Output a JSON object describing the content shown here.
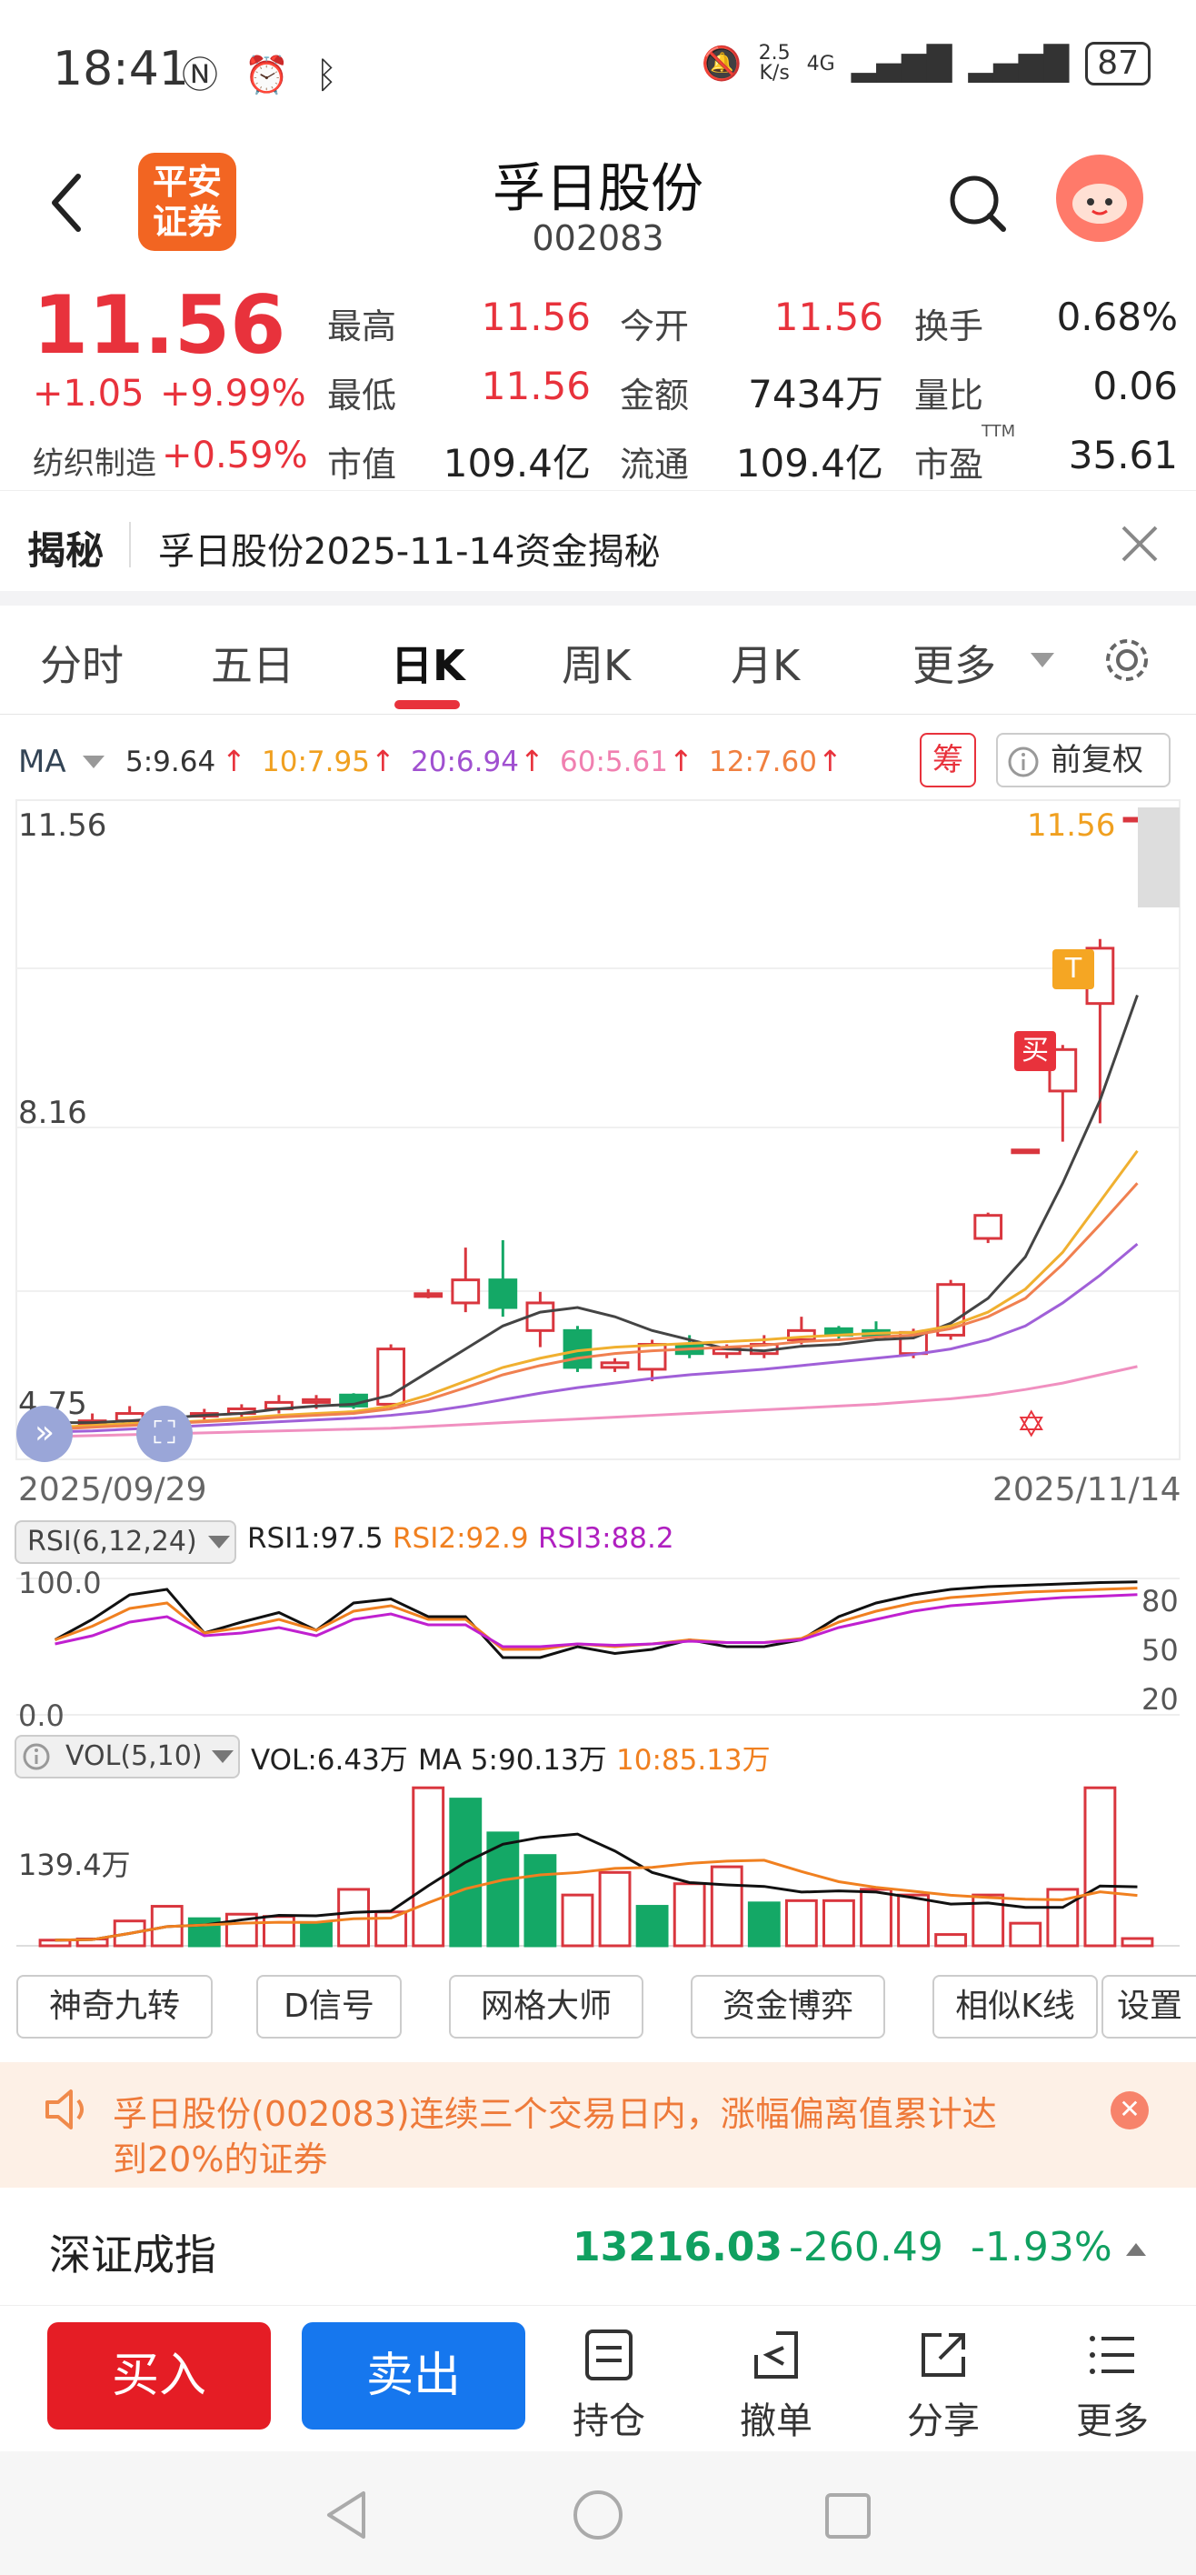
{
  "status_bar": {
    "time": "18:41",
    "network_speed_top": "2.5",
    "network_speed_bottom": "K/s",
    "network_type": "4G",
    "battery": "87"
  },
  "header": {
    "title": "孚日股份",
    "code": "002083",
    "logo_line1": "平安",
    "logo_line2": "证券"
  },
  "quote": {
    "price": "11.56",
    "change": "+1.05",
    "change_pct": "+9.99%",
    "sector_name": "纺织制造",
    "sector_pct": "+0.59%",
    "fields": [
      {
        "label": "最高",
        "value": "11.56"
      },
      {
        "label": "今开",
        "value": "11.56"
      },
      {
        "label": "换手",
        "value": "0.68%"
      },
      {
        "label": "最低",
        "value": "11.56"
      },
      {
        "label": "金额",
        "value": "7434万"
      },
      {
        "label": "量比",
        "value": "0.06"
      },
      {
        "label": "市值",
        "value": "109.4亿"
      },
      {
        "label": "流通",
        "value": "109.4亿"
      },
      {
        "label": "市盈",
        "value": "35.61",
        "sup": "TTM"
      }
    ]
  },
  "reveal": {
    "tag": "揭秘",
    "text": "孚日股份2025-11-14资金揭秘"
  },
  "tabs": [
    "分时",
    "五日",
    "日K",
    "周K",
    "月K",
    "更多"
  ],
  "active_tab": "日K",
  "ma": {
    "label": "MA",
    "items": [
      {
        "text": "5:9.64",
        "color": "#333333"
      },
      {
        "text": "10:7.95",
        "color": "#f0a020"
      },
      {
        "text": "20:6.94",
        "color": "#a050d0"
      },
      {
        "text": "60:5.61",
        "color": "#f080b0"
      },
      {
        "text": "12:7.60",
        "color": "#f08040"
      }
    ],
    "chip_button": "筹",
    "adjust_button": "前复权"
  },
  "kline": {
    "y_high": "11.56",
    "y_mid": "8.16",
    "y_low": "4.75",
    "last_price_label": "11.56",
    "date_start": "2025/09/29",
    "date_end": "2025/11/14",
    "buy_marker": "买",
    "t_marker": "T"
  },
  "rsi": {
    "selector": "RSI(6,12,24)",
    "rsi1": "RSI1:97.5",
    "rsi2": "RSI2:92.9",
    "rsi3": "RSI3:88.2",
    "ticks": [
      "100.0",
      "0.0"
    ],
    "right_ticks": [
      "80",
      "50",
      "20"
    ]
  },
  "vol": {
    "selector": "VOL(5,10)",
    "vol": "VOL:6.43万",
    "ma5": "MA 5:90.13万",
    "ma10": "10:85.13万",
    "y_label": "139.4万"
  },
  "tools": [
    "神奇九转",
    "D信号",
    "网格大师",
    "资金博弈",
    "相似K线",
    "设置"
  ],
  "alert": {
    "text_line1": "孚日股份(002083)连续三个交易日内，涨幅偏离值累计达",
    "text_line2": "到20%的证券"
  },
  "index": {
    "name": "深证成指",
    "value": "13216.03",
    "change": "-260.49",
    "pct": "-1.93%"
  },
  "trade": {
    "buy": "买入",
    "sell": "卖出",
    "actions": [
      {
        "label": "持仓",
        "icon": "document-icon"
      },
      {
        "label": "撤单",
        "icon": "undo-icon"
      },
      {
        "label": "分享",
        "icon": "share-icon"
      },
      {
        "label": "更多",
        "icon": "list-icon"
      }
    ]
  },
  "chart_data": [
    {
      "type": "candlestick",
      "x_range": [
        "2025/09/29",
        "2025/11/14"
      ],
      "ylim": [
        4.75,
        11.56
      ],
      "candles": [
        {
          "o": 4.95,
          "c": 5.0,
          "h": 5.05,
          "l": 4.88
        },
        {
          "o": 5.0,
          "c": 5.02,
          "h": 5.1,
          "l": 4.95
        },
        {
          "o": 5.02,
          "c": 5.1,
          "h": 5.18,
          "l": 4.98
        },
        {
          "o": 5.05,
          "c": 5.08,
          "h": 5.15,
          "l": 5.0
        },
        {
          "o": 5.08,
          "c": 5.1,
          "h": 5.15,
          "l": 5.02
        },
        {
          "o": 5.1,
          "c": 5.15,
          "h": 5.2,
          "l": 5.05
        },
        {
          "o": 5.15,
          "c": 5.22,
          "h": 5.3,
          "l": 5.1
        },
        {
          "o": 5.22,
          "c": 5.25,
          "h": 5.3,
          "l": 5.15
        },
        {
          "o": 5.3,
          "c": 5.18,
          "h": 5.32,
          "l": 5.15
        },
        {
          "o": 5.2,
          "c": 5.8,
          "h": 5.85,
          "l": 5.15
        },
        {
          "o": 6.38,
          "c": 6.4,
          "h": 6.45,
          "l": 6.35
        },
        {
          "o": 6.3,
          "c": 6.55,
          "h": 6.9,
          "l": 6.2
        },
        {
          "o": 6.55,
          "c": 6.25,
          "h": 6.98,
          "l": 6.15
        },
        {
          "o": 6.0,
          "c": 6.3,
          "h": 6.42,
          "l": 5.82
        },
        {
          "o": 6.0,
          "c": 5.6,
          "h": 6.05,
          "l": 5.55
        },
        {
          "o": 5.6,
          "c": 5.65,
          "h": 5.7,
          "l": 5.55
        },
        {
          "o": 5.58,
          "c": 5.85,
          "h": 5.9,
          "l": 5.45
        },
        {
          "o": 5.85,
          "c": 5.75,
          "h": 5.95,
          "l": 5.7
        },
        {
          "o": 5.75,
          "c": 5.8,
          "h": 5.85,
          "l": 5.7
        },
        {
          "o": 5.75,
          "c": 5.85,
          "h": 5.95,
          "l": 5.7
        },
        {
          "o": 5.9,
          "c": 6.0,
          "h": 6.15,
          "l": 5.85
        },
        {
          "o": 6.02,
          "c": 5.95,
          "h": 6.05,
          "l": 5.9
        },
        {
          "o": 6.0,
          "c": 5.95,
          "h": 6.1,
          "l": 5.9
        },
        {
          "o": 5.75,
          "c": 5.98,
          "h": 6.02,
          "l": 5.7
        },
        {
          "o": 5.95,
          "c": 6.5,
          "h": 6.55,
          "l": 5.9
        },
        {
          "o": 7.0,
          "c": 7.25,
          "h": 7.28,
          "l": 6.95
        },
        {
          "o": 7.95,
          "c": 7.96,
          "h": 7.97,
          "l": 7.94
        },
        {
          "o": 8.6,
          "c": 9.05,
          "h": 9.1,
          "l": 8.05
        },
        {
          "o": 9.55,
          "c": 10.15,
          "h": 10.25,
          "l": 8.25
        },
        {
          "o": 11.56,
          "c": 11.56,
          "h": 11.56,
          "l": 11.56
        }
      ],
      "ma_lines": {
        "MA5": [
          5.0,
          5.0,
          5.02,
          5.05,
          5.08,
          5.1,
          5.15,
          5.18,
          5.2,
          5.3,
          5.55,
          5.8,
          6.05,
          6.2,
          6.25,
          6.15,
          6.0,
          5.9,
          5.8,
          5.78,
          5.83,
          5.85,
          5.9,
          5.92,
          6.08,
          6.35,
          6.8,
          7.6,
          8.5,
          9.64
        ],
        "MA10": [
          4.95,
          4.97,
          4.99,
          5.0,
          5.02,
          5.05,
          5.08,
          5.1,
          5.12,
          5.18,
          5.3,
          5.45,
          5.6,
          5.7,
          5.78,
          5.82,
          5.84,
          5.86,
          5.88,
          5.9,
          5.93,
          5.95,
          5.97,
          5.98,
          6.05,
          6.2,
          6.45,
          6.85,
          7.4,
          7.95
        ],
        "MA20": [
          4.9,
          4.91,
          4.93,
          4.95,
          4.97,
          4.99,
          5.01,
          5.03,
          5.05,
          5.08,
          5.12,
          5.18,
          5.25,
          5.32,
          5.38,
          5.43,
          5.48,
          5.52,
          5.55,
          5.58,
          5.62,
          5.66,
          5.7,
          5.74,
          5.8,
          5.9,
          6.05,
          6.3,
          6.6,
          6.94
        ],
        "MA60": [
          4.85,
          4.86,
          4.87,
          4.88,
          4.89,
          4.9,
          4.91,
          4.92,
          4.93,
          4.94,
          4.96,
          4.98,
          5.0,
          5.02,
          5.04,
          5.06,
          5.08,
          5.1,
          5.12,
          5.14,
          5.16,
          5.18,
          5.2,
          5.23,
          5.26,
          5.3,
          5.36,
          5.43,
          5.52,
          5.61
        ],
        "MA12": [
          4.93,
          4.95,
          4.97,
          4.99,
          5.01,
          5.03,
          5.06,
          5.08,
          5.1,
          5.15,
          5.25,
          5.38,
          5.52,
          5.62,
          5.7,
          5.75,
          5.78,
          5.8,
          5.82,
          5.84,
          5.88,
          5.9,
          5.93,
          5.95,
          6.02,
          6.15,
          6.35,
          6.72,
          7.15,
          7.6
        ]
      }
    },
    {
      "type": "line",
      "title": "RSI(6,12,24)",
      "ylim": [
        0,
        100
      ],
      "series": [
        {
          "name": "RSI1",
          "values": [
            55,
            70,
            88,
            92,
            60,
            68,
            75,
            62,
            82,
            85,
            72,
            72,
            42,
            42,
            50,
            45,
            48,
            55,
            50,
            50,
            55,
            72,
            82,
            88,
            92,
            94,
            95,
            96,
            97,
            97.5
          ]
        },
        {
          "name": "RSI2",
          "values": [
            55,
            65,
            78,
            82,
            60,
            64,
            70,
            62,
            76,
            80,
            70,
            70,
            48,
            48,
            52,
            50,
            52,
            55,
            53,
            53,
            56,
            68,
            76,
            82,
            86,
            88,
            90,
            91,
            92,
            92.9
          ]
        },
        {
          "name": "RSI3",
          "values": [
            52,
            58,
            68,
            72,
            58,
            60,
            64,
            58,
            70,
            74,
            66,
            66,
            50,
            50,
            52,
            51,
            52,
            54,
            53,
            53,
            55,
            64,
            70,
            76,
            80,
            82,
            84,
            86,
            87,
            88.2
          ]
        }
      ]
    },
    {
      "type": "bar",
      "title": "VOL(5,10)",
      "y_label": "139.4万",
      "series": [
        {
          "name": "VOL",
          "values": [
            5,
            6,
            22,
            35,
            24,
            28,
            26,
            20,
            50,
            30,
            140,
            130,
            100,
            80,
            45,
            65,
            35,
            55,
            70,
            38,
            40,
            40,
            50,
            45,
            10,
            45,
            20,
            50,
            140,
            6.43
          ]
        }
      ],
      "up": [
        true,
        true,
        true,
        true,
        false,
        true,
        true,
        false,
        true,
        true,
        true,
        false,
        false,
        false,
        true,
        true,
        false,
        true,
        true,
        false,
        true,
        true,
        true,
        true,
        true,
        true,
        true,
        true,
        true,
        true
      ]
    }
  ]
}
